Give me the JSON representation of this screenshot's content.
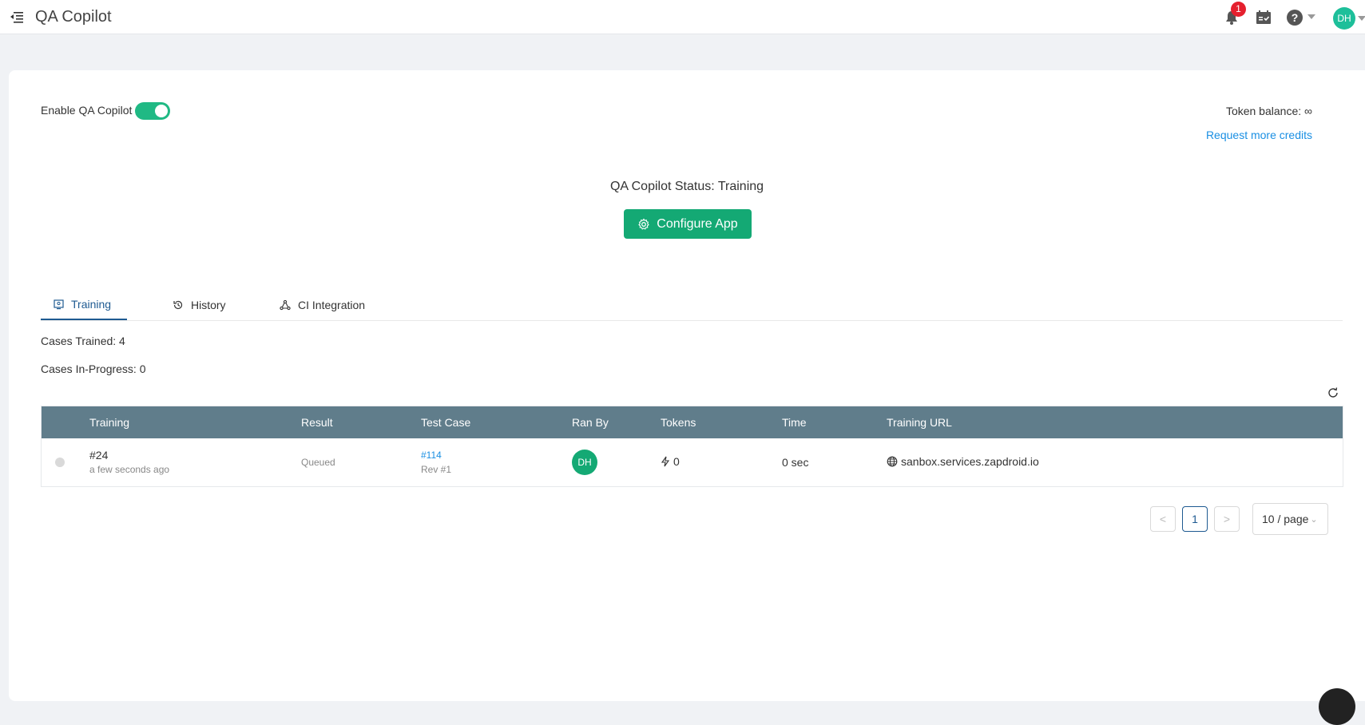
{
  "header": {
    "title": "QA Copilot",
    "notification_count": "1",
    "user_initials": "DH"
  },
  "settings": {
    "enable_label": "Enable QA Copilot",
    "enabled": true,
    "token_balance": "Token balance: ∞",
    "request_credits": "Request more credits"
  },
  "status": {
    "text": "QA Copilot Status: Training",
    "configure_label": "Configure App"
  },
  "tabs": [
    {
      "label": "Training",
      "active": true
    },
    {
      "label": "History",
      "active": false
    },
    {
      "label": "CI Integration",
      "active": false
    }
  ],
  "stats": {
    "trained": "Cases Trained: 4",
    "in_progress": "Cases In-Progress: 0"
  },
  "table": {
    "columns": [
      "Training",
      "Result",
      "Test Case",
      "Ran By",
      "Tokens",
      "Time",
      "Training URL"
    ],
    "rows": [
      {
        "id": "#24",
        "when": "a few seconds ago",
        "result": "Queued",
        "test_case": "#114",
        "revision": "Rev #1",
        "ran_by": "DH",
        "tokens": "0",
        "time": "0 sec",
        "url": "sanbox.services.zapdroid.io"
      }
    ]
  },
  "pagination": {
    "current_page": "1",
    "page_size": "10 / page"
  },
  "colors": {
    "accent_green": "#14a974",
    "toggle_green": "#20b984",
    "table_header": "#607d8b",
    "link_blue": "#1a8fe3",
    "tab_active": "#1e5a91",
    "badge_red": "#e5202e"
  }
}
